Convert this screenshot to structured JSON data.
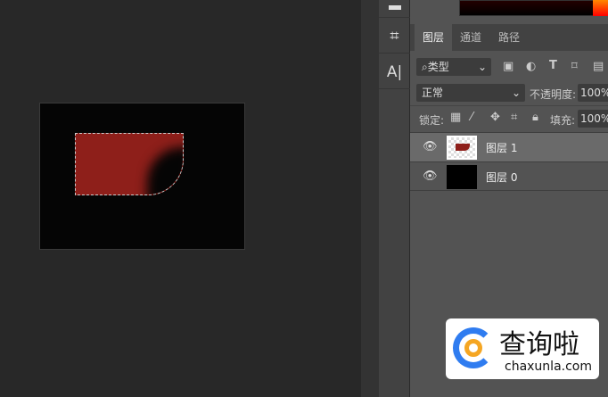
{
  "tools": [
    {
      "icon": "crop-icon",
      "glyph": "⌗"
    },
    {
      "icon": "type-tool-icon",
      "glyph": "A|"
    }
  ],
  "panel": {
    "tabs": [
      "图层",
      "通道",
      "路径"
    ],
    "filter": {
      "label": "类型"
    },
    "blend_mode": "正常",
    "opacity_label": "不透明度:",
    "opacity": "100%",
    "lock_label": "锁定:",
    "fill_label": "填充:",
    "fill": "100%",
    "layers": [
      {
        "name": "图层 1",
        "selected": true
      },
      {
        "name": "图层 0",
        "selected": false
      }
    ]
  },
  "watermark": {
    "text": "查询啦",
    "url": "chaxunla.com"
  },
  "colors": {
    "layer_fill": "#8e1f1a",
    "panel_bg": "#535353"
  }
}
